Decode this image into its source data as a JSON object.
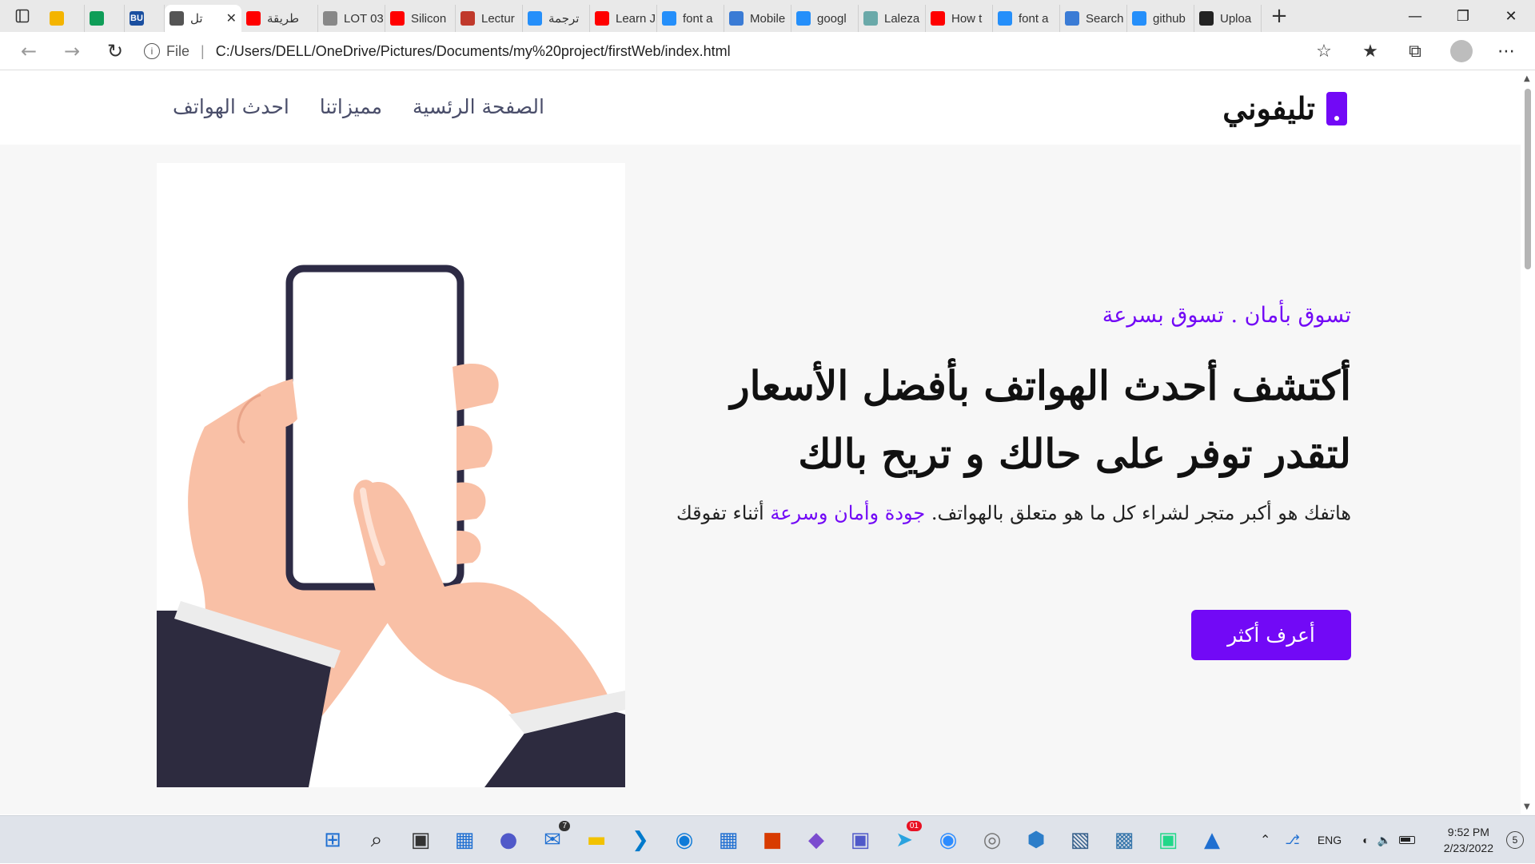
{
  "browser": {
    "tabs": [
      {
        "label": "",
        "icon": "google-drive-icon",
        "color": "#f4b400"
      },
      {
        "label": "",
        "icon": "google-drive-icon",
        "color": "#0f9d58"
      },
      {
        "label": "BU",
        "icon": "bu-icon",
        "color": "#1a4fa0"
      },
      {
        "label": "تل",
        "icon": "document-icon",
        "color": "#555555",
        "active": true
      },
      {
        "label": "طريقة",
        "icon": "youtube-icon",
        "color": "#ff0000"
      },
      {
        "label": "LOT 03",
        "icon": "document-icon",
        "color": "#888888"
      },
      {
        "label": "Silicon",
        "icon": "youtube-icon",
        "color": "#ff0000"
      },
      {
        "label": "Lectur",
        "icon": "pdf-icon",
        "color": "#c0392b"
      },
      {
        "label": "ترجمة",
        "icon": "bing-icon",
        "color": "#258ffa"
      },
      {
        "label": "Learn J",
        "icon": "youtube-icon",
        "color": "#ff0000"
      },
      {
        "label": "font a",
        "icon": "bing-icon",
        "color": "#258ffa"
      },
      {
        "label": "Mobile",
        "icon": "flag-icon",
        "color": "#3a7bd5"
      },
      {
        "label": "googl",
        "icon": "bing-icon",
        "color": "#258ffa"
      },
      {
        "label": "Laleza",
        "icon": "puzzle-icon",
        "color": "#6aa9a9"
      },
      {
        "label": "How t",
        "icon": "youtube-icon",
        "color": "#ff0000"
      },
      {
        "label": "font a",
        "icon": "bing-icon",
        "color": "#258ffa"
      },
      {
        "label": "Search",
        "icon": "flag-icon",
        "color": "#3a7bd5"
      },
      {
        "label": "github",
        "icon": "bing-icon",
        "color": "#258ffa"
      },
      {
        "label": "Uploa",
        "icon": "github-icon",
        "color": "#222222"
      }
    ],
    "address": {
      "scheme_label": "File",
      "url": "C:/Users/DELL/OneDrive/Pictures/Documents/my%20project/firstWeb/index.html"
    }
  },
  "site": {
    "brand": "تليفوني",
    "nav": [
      "الصفحة الرئسية",
      "مميزاتنا",
      "احدث الهواتف"
    ],
    "tagline": "تسوق بأمان . تسوق بسرعة",
    "headline": "أكتشف أحدث الهواتف بأفضل الأسعار لتقدر توفر على حالك و تريح بالك",
    "description_main": "هاتفك هو أكبر متجر لشراء كل ما هو متعلق بالهواتف. ",
    "description_highlight": "جودة وأمان وسرعة",
    "description_end": " أثناء تفوقك",
    "cta": "أعرف أكثر",
    "accent_color": "#7209f6"
  },
  "taskbar": {
    "apps": [
      "windows-start-icon",
      "search-icon",
      "task-view-icon",
      "widgets-icon",
      "teams-chat-icon",
      "mail-icon",
      "file-explorer-icon",
      "vscode-icon",
      "edge-icon",
      "store-icon",
      "office-icon",
      "visual-studio-icon",
      "teams-icon",
      "telegram-icon",
      "zoom-icon",
      "app-icon",
      "cube-icon",
      "terminal-icon",
      "python-icon",
      "pycharm-icon",
      "photos-icon"
    ],
    "mail_badge": "7",
    "telegram_badge": "01",
    "language": "ENG",
    "time": "9:52 PM",
    "date": "2/23/2022",
    "notifications": "5"
  }
}
